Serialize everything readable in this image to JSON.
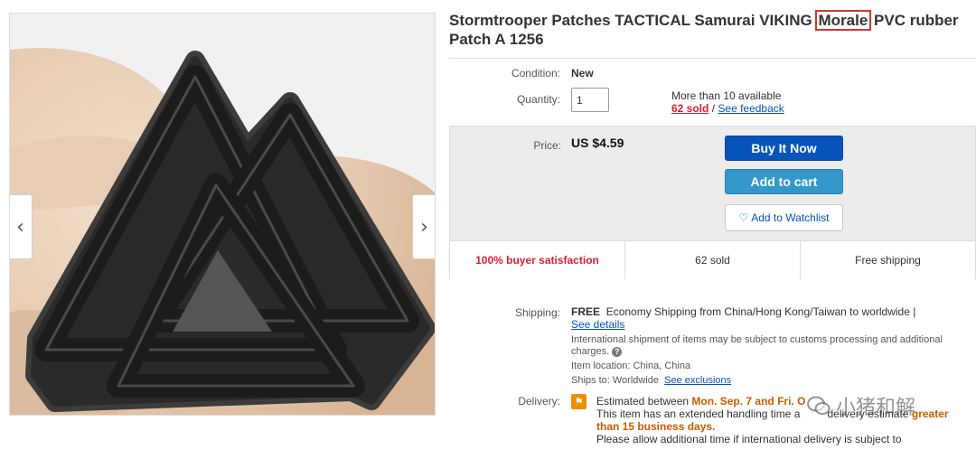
{
  "listing": {
    "title_before": "Stormtrooper Patches TACTICAL Samurai VIKING ",
    "title_highlight": "Morale",
    "title_after": " PVC rubber Patch A 1256"
  },
  "gallery": {
    "prev_glyph": "‹",
    "next_glyph": "›"
  },
  "details": {
    "condition_label": "Condition:",
    "condition_value": "New",
    "quantity_label": "Quantity:",
    "quantity_value": "1",
    "available_text": "More than 10 available",
    "sold_link": "62 sold",
    "separator": "/",
    "feedback_link": "See feedback"
  },
  "purchase": {
    "price_label": "Price:",
    "price_value": "US $4.59",
    "buy_now": "Buy It Now",
    "add_to_cart": "Add to cart",
    "watchlist": "Add to Watchlist",
    "stats": [
      "100% buyer satisfaction",
      "62 sold",
      "Free shipping"
    ]
  },
  "shipping": {
    "label": "Shipping:",
    "free": "FREE",
    "description": "Economy Shipping from China/Hong Kong/Taiwan to worldwide |",
    "see_details": "See details",
    "intl_note": "International shipment of items may be subject to customs processing and additional charges.",
    "help_glyph": "?",
    "location_label": "Item location:",
    "location_value": "China, China",
    "ships_to_label": "Ships to:",
    "ships_to_value": "Worldwide",
    "exclusions_link": "See exclusions"
  },
  "delivery": {
    "label": "Delivery:",
    "estimated_prefix": "Estimated between",
    "estimated_dates": "Mon. Sep. 7 and Fri. O",
    "line2_a": "This item has an extended handling time a",
    "line2_b": "delivery estimate",
    "greater": "greater",
    "line3": "than 15 business days.",
    "line4": "Please allow additional time if international delivery is subject to"
  },
  "watermark": {
    "text": "小猪和解"
  },
  "colors": {
    "ebay_blue": "#0654ba",
    "cart_blue": "#3498ca",
    "alert_red": "#dd1e31",
    "highlight_box": "#d9342b"
  }
}
